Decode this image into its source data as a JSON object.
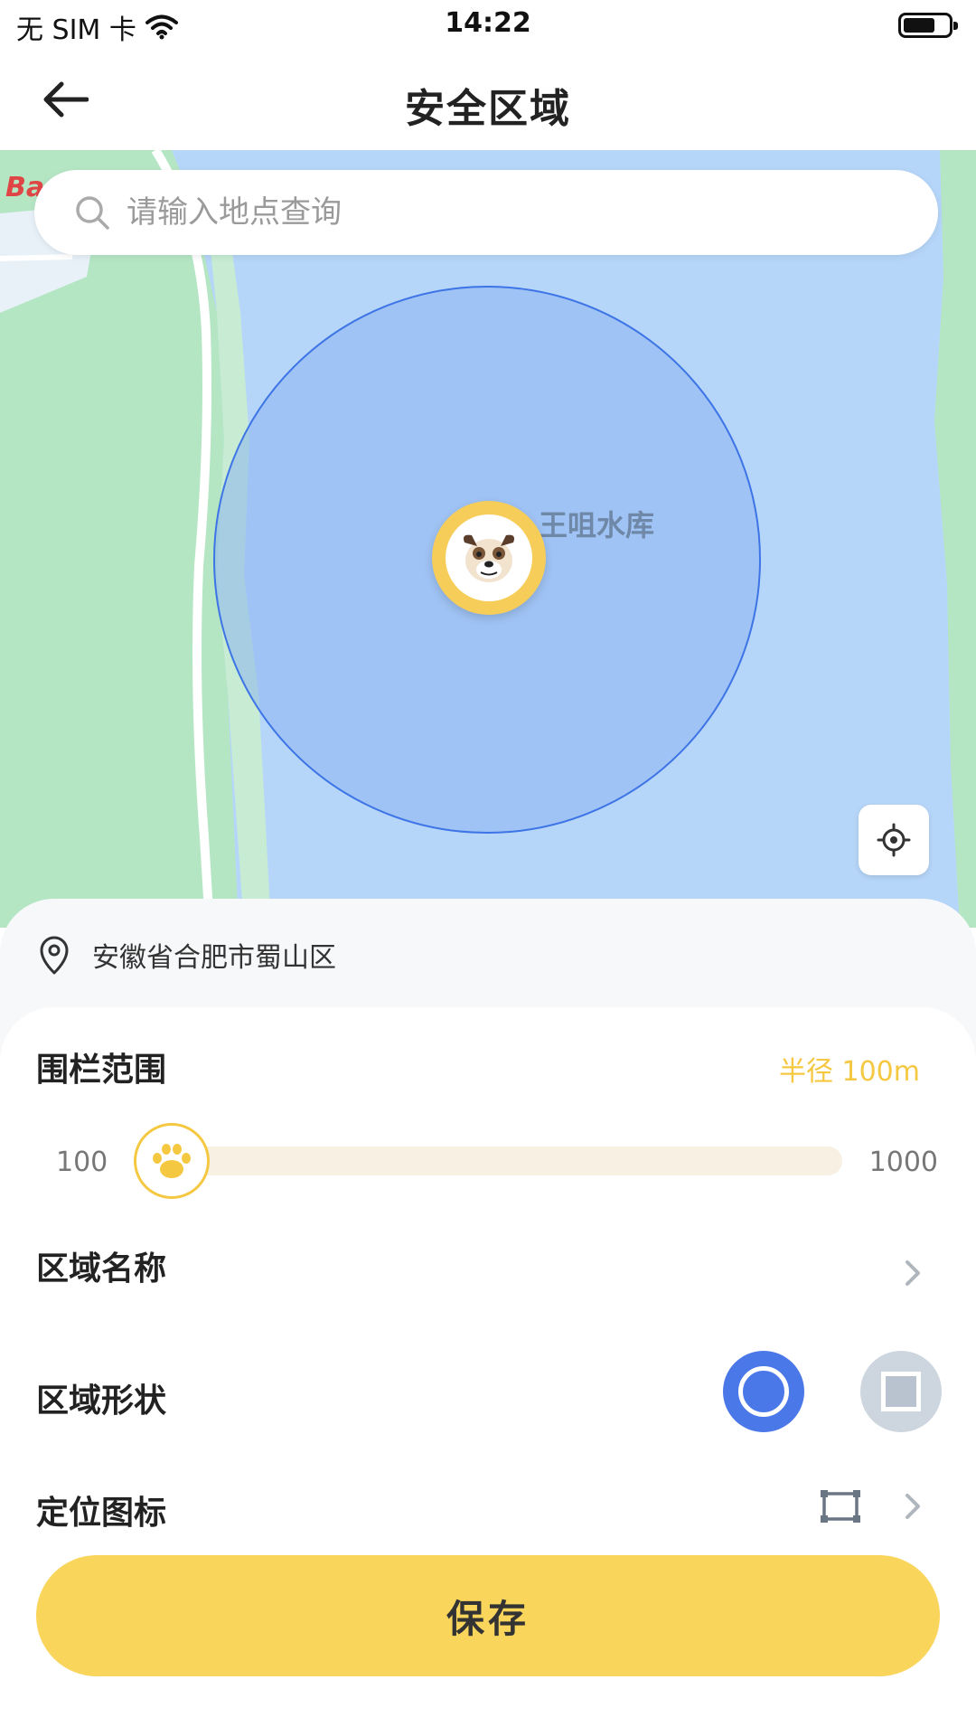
{
  "status_bar": {
    "carrier": "无 SIM 卡",
    "time": "14:22"
  },
  "nav": {
    "title": "安全区域"
  },
  "map": {
    "search_placeholder": "请输入地点查询",
    "place_label": "王咀水库",
    "logo_text": "Ba"
  },
  "address": {
    "text": "安徽省合肥市蜀山区"
  },
  "fence_range": {
    "label": "围栏范围",
    "radius_text": "半径 100m",
    "slider_min": "100",
    "slider_max": "1000",
    "slider_value_fraction": 0.0
  },
  "area_name": {
    "label": "区域名称"
  },
  "area_shape": {
    "label": "区域形状",
    "options": [
      "circle",
      "square"
    ],
    "selected": "circle"
  },
  "location_icon": {
    "label": "定位图标"
  },
  "save_button": {
    "label": "保存"
  },
  "colors": {
    "accent_yellow": "#f9d55c",
    "radius_text": "#f5c842",
    "shape_selected": "#4a78e8",
    "shape_unselected": "#cdd5de",
    "fence_border": "#3d74e6"
  },
  "icons": [
    "back-arrow-icon",
    "wifi-icon",
    "battery-icon",
    "search-icon",
    "locate-icon",
    "location-pin-icon",
    "paw-icon",
    "chevron-right-icon",
    "circle-shape-icon",
    "square-shape-icon",
    "marker-frame-icon",
    "dog-avatar-icon"
  ]
}
